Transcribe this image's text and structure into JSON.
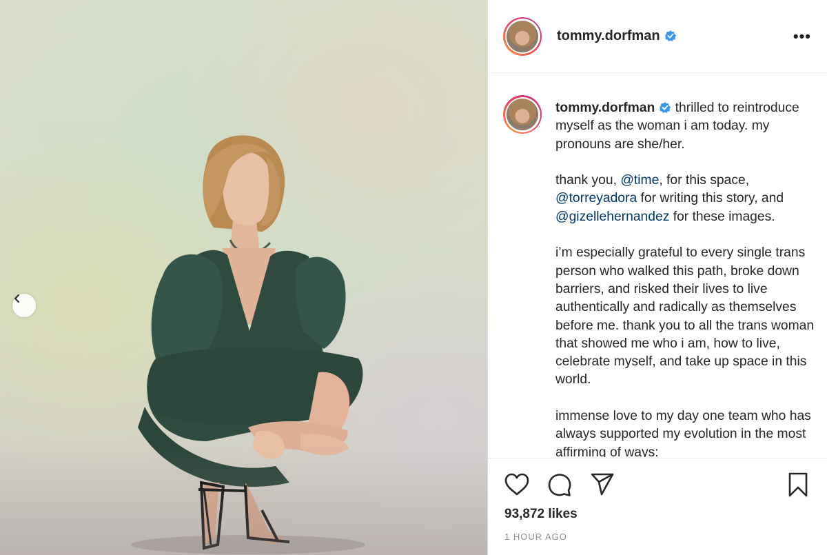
{
  "post": {
    "username": "tommy.dorfman",
    "more_label": "•••",
    "caption_lines": {
      "p1_text": " thrilled to reintroduce myself as the woman i am today. my pronouns are she/her.",
      "p2_a": "thank you, ",
      "mention_time": "@time",
      "p2_b": ", for this space, ",
      "mention_torrey": "@torreyadora",
      "p2_c": " for writing this story, and ",
      "mention_gizelle": "@gizellehernandez",
      "p2_d": " for these images.",
      "p3": "i’m especially grateful to every single trans person who walked this path, broke down barriers, and risked their lives to live authentically and radically as themselves before me. thank you to all the trans woman that showed me who i am, how to live, celebrate myself, and take up space in this world.",
      "p4": "immense love to my day one team who has always supported my evolution in the most affirming of ways:"
    },
    "likes": "93,872 likes",
    "timestamp": "1 HOUR AGO"
  },
  "icons": {
    "like": "heart-icon",
    "comment": "comment-icon",
    "share": "share-icon",
    "save": "bookmark-icon",
    "prev": "chevron-left-icon",
    "verified": "verified-badge-icon",
    "more": "more-options-icon"
  },
  "colors": {
    "mention": "#00376b",
    "verified": "#3897f0",
    "text": "#262626",
    "muted": "#8e8e8e"
  }
}
